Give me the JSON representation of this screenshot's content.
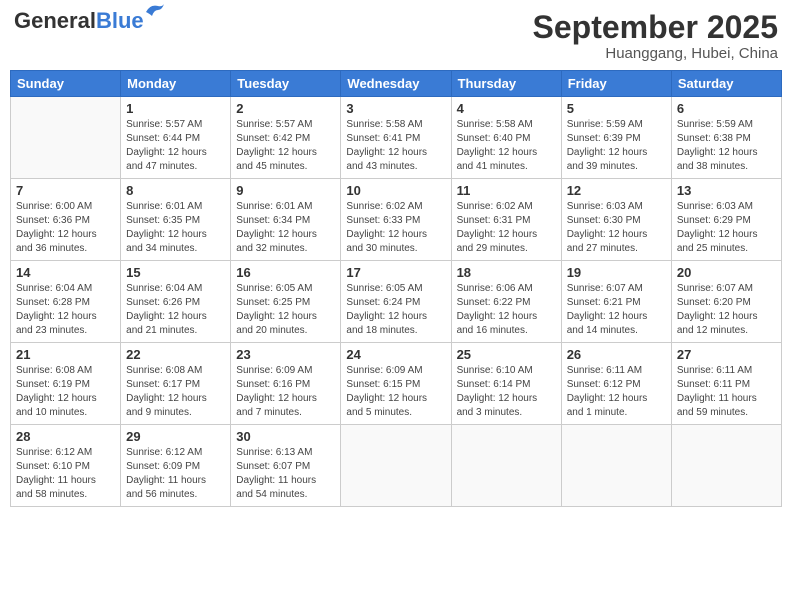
{
  "header": {
    "logo_general": "General",
    "logo_blue": "Blue",
    "month_year": "September 2025",
    "location": "Huanggang, Hubei, China"
  },
  "columns": [
    "Sunday",
    "Monday",
    "Tuesday",
    "Wednesday",
    "Thursday",
    "Friday",
    "Saturday"
  ],
  "weeks": [
    [
      {
        "day": "",
        "sunrise": "",
        "sunset": "",
        "daylight": ""
      },
      {
        "day": "1",
        "sunrise": "Sunrise: 5:57 AM",
        "sunset": "Sunset: 6:44 PM",
        "daylight": "Daylight: 12 hours and 47 minutes."
      },
      {
        "day": "2",
        "sunrise": "Sunrise: 5:57 AM",
        "sunset": "Sunset: 6:42 PM",
        "daylight": "Daylight: 12 hours and 45 minutes."
      },
      {
        "day": "3",
        "sunrise": "Sunrise: 5:58 AM",
        "sunset": "Sunset: 6:41 PM",
        "daylight": "Daylight: 12 hours and 43 minutes."
      },
      {
        "day": "4",
        "sunrise": "Sunrise: 5:58 AM",
        "sunset": "Sunset: 6:40 PM",
        "daylight": "Daylight: 12 hours and 41 minutes."
      },
      {
        "day": "5",
        "sunrise": "Sunrise: 5:59 AM",
        "sunset": "Sunset: 6:39 PM",
        "daylight": "Daylight: 12 hours and 39 minutes."
      },
      {
        "day": "6",
        "sunrise": "Sunrise: 5:59 AM",
        "sunset": "Sunset: 6:38 PM",
        "daylight": "Daylight: 12 hours and 38 minutes."
      }
    ],
    [
      {
        "day": "7",
        "sunrise": "Sunrise: 6:00 AM",
        "sunset": "Sunset: 6:36 PM",
        "daylight": "Daylight: 12 hours and 36 minutes."
      },
      {
        "day": "8",
        "sunrise": "Sunrise: 6:01 AM",
        "sunset": "Sunset: 6:35 PM",
        "daylight": "Daylight: 12 hours and 34 minutes."
      },
      {
        "day": "9",
        "sunrise": "Sunrise: 6:01 AM",
        "sunset": "Sunset: 6:34 PM",
        "daylight": "Daylight: 12 hours and 32 minutes."
      },
      {
        "day": "10",
        "sunrise": "Sunrise: 6:02 AM",
        "sunset": "Sunset: 6:33 PM",
        "daylight": "Daylight: 12 hours and 30 minutes."
      },
      {
        "day": "11",
        "sunrise": "Sunrise: 6:02 AM",
        "sunset": "Sunset: 6:31 PM",
        "daylight": "Daylight: 12 hours and 29 minutes."
      },
      {
        "day": "12",
        "sunrise": "Sunrise: 6:03 AM",
        "sunset": "Sunset: 6:30 PM",
        "daylight": "Daylight: 12 hours and 27 minutes."
      },
      {
        "day": "13",
        "sunrise": "Sunrise: 6:03 AM",
        "sunset": "Sunset: 6:29 PM",
        "daylight": "Daylight: 12 hours and 25 minutes."
      }
    ],
    [
      {
        "day": "14",
        "sunrise": "Sunrise: 6:04 AM",
        "sunset": "Sunset: 6:28 PM",
        "daylight": "Daylight: 12 hours and 23 minutes."
      },
      {
        "day": "15",
        "sunrise": "Sunrise: 6:04 AM",
        "sunset": "Sunset: 6:26 PM",
        "daylight": "Daylight: 12 hours and 21 minutes."
      },
      {
        "day": "16",
        "sunrise": "Sunrise: 6:05 AM",
        "sunset": "Sunset: 6:25 PM",
        "daylight": "Daylight: 12 hours and 20 minutes."
      },
      {
        "day": "17",
        "sunrise": "Sunrise: 6:05 AM",
        "sunset": "Sunset: 6:24 PM",
        "daylight": "Daylight: 12 hours and 18 minutes."
      },
      {
        "day": "18",
        "sunrise": "Sunrise: 6:06 AM",
        "sunset": "Sunset: 6:22 PM",
        "daylight": "Daylight: 12 hours and 16 minutes."
      },
      {
        "day": "19",
        "sunrise": "Sunrise: 6:07 AM",
        "sunset": "Sunset: 6:21 PM",
        "daylight": "Daylight: 12 hours and 14 minutes."
      },
      {
        "day": "20",
        "sunrise": "Sunrise: 6:07 AM",
        "sunset": "Sunset: 6:20 PM",
        "daylight": "Daylight: 12 hours and 12 minutes."
      }
    ],
    [
      {
        "day": "21",
        "sunrise": "Sunrise: 6:08 AM",
        "sunset": "Sunset: 6:19 PM",
        "daylight": "Daylight: 12 hours and 10 minutes."
      },
      {
        "day": "22",
        "sunrise": "Sunrise: 6:08 AM",
        "sunset": "Sunset: 6:17 PM",
        "daylight": "Daylight: 12 hours and 9 minutes."
      },
      {
        "day": "23",
        "sunrise": "Sunrise: 6:09 AM",
        "sunset": "Sunset: 6:16 PM",
        "daylight": "Daylight: 12 hours and 7 minutes."
      },
      {
        "day": "24",
        "sunrise": "Sunrise: 6:09 AM",
        "sunset": "Sunset: 6:15 PM",
        "daylight": "Daylight: 12 hours and 5 minutes."
      },
      {
        "day": "25",
        "sunrise": "Sunrise: 6:10 AM",
        "sunset": "Sunset: 6:14 PM",
        "daylight": "Daylight: 12 hours and 3 minutes."
      },
      {
        "day": "26",
        "sunrise": "Sunrise: 6:11 AM",
        "sunset": "Sunset: 6:12 PM",
        "daylight": "Daylight: 12 hours and 1 minute."
      },
      {
        "day": "27",
        "sunrise": "Sunrise: 6:11 AM",
        "sunset": "Sunset: 6:11 PM",
        "daylight": "Daylight: 11 hours and 59 minutes."
      }
    ],
    [
      {
        "day": "28",
        "sunrise": "Sunrise: 6:12 AM",
        "sunset": "Sunset: 6:10 PM",
        "daylight": "Daylight: 11 hours and 58 minutes."
      },
      {
        "day": "29",
        "sunrise": "Sunrise: 6:12 AM",
        "sunset": "Sunset: 6:09 PM",
        "daylight": "Daylight: 11 hours and 56 minutes."
      },
      {
        "day": "30",
        "sunrise": "Sunrise: 6:13 AM",
        "sunset": "Sunset: 6:07 PM",
        "daylight": "Daylight: 11 hours and 54 minutes."
      },
      {
        "day": "",
        "sunrise": "",
        "sunset": "",
        "daylight": ""
      },
      {
        "day": "",
        "sunrise": "",
        "sunset": "",
        "daylight": ""
      },
      {
        "day": "",
        "sunrise": "",
        "sunset": "",
        "daylight": ""
      },
      {
        "day": "",
        "sunrise": "",
        "sunset": "",
        "daylight": ""
      }
    ]
  ]
}
